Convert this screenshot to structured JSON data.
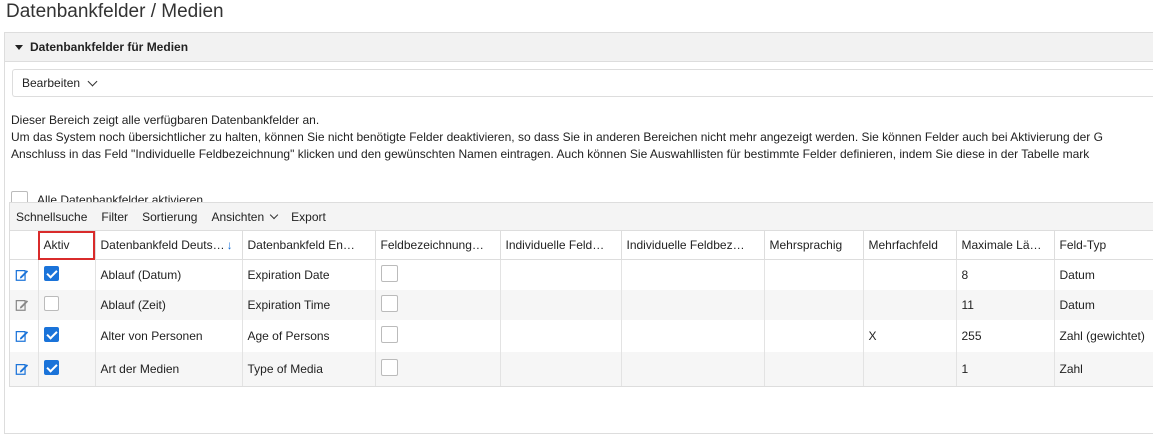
{
  "page": {
    "title": "Datenbankfelder / Medien"
  },
  "panel": {
    "title": "Datenbankfelder für Medien"
  },
  "edit_menu": {
    "label": "Bearbeiten"
  },
  "description": {
    "line1": "Dieser Bereich zeigt alle verfügbaren Datenbankfelder an.",
    "line2": "Um das System noch übersichtlicher zu halten, können Sie nicht benötigte Felder deaktivieren, so dass Sie in anderen Bereichen nicht mehr angezeigt werden. Sie können Felder auch bei Aktivierung der G",
    "line3": "Anschluss in das Feld \"Individuelle Feldbezeichnung\" klicken und den gewünschten Namen eintragen. Auch können Sie Auswahllisten für bestimmte Felder definieren, indem Sie diese in der Tabelle mark"
  },
  "activate_all": {
    "label": "Alle Datenbankfelder aktivieren",
    "checked": false
  },
  "toolbar": {
    "quicksearch": "Schnellsuche",
    "filter": "Filter",
    "sort": "Sortierung",
    "views": "Ansichten",
    "export": "Export"
  },
  "table": {
    "headers": {
      "aktiv": "Aktiv",
      "feld_de": "Datenbankfeld Deuts…",
      "feld_en": "Datenbankfeld En…",
      "feldbez": "Feldbezeichnung…",
      "indiv1": "Individuelle Feld…",
      "indiv2": "Individuelle Feldbez…",
      "mehrsprachig": "Mehrsprachig",
      "mehrfach": "Mehrfachfeld",
      "maxlen": "Maximale Lä…",
      "typ": "Feld-Typ"
    },
    "colors": {
      "accent": "#1a73d9",
      "highlight": "#d92b2b"
    },
    "rows": [
      {
        "aktiv": true,
        "feld_de": "Ablauf (Datum)",
        "feld_en": "Expiration Date",
        "mehrfach": "",
        "maxlen": "8",
        "typ": "Datum"
      },
      {
        "aktiv": false,
        "feld_de": "Ablauf (Zeit)",
        "feld_en": "Expiration Time",
        "mehrfach": "",
        "maxlen": "11",
        "typ": "Datum"
      },
      {
        "aktiv": true,
        "feld_de": "Alter von Personen",
        "feld_en": "Age of Persons",
        "mehrfach": "X",
        "maxlen": "255",
        "typ": "Zahl (gewichtet)"
      },
      {
        "aktiv": true,
        "feld_de": "Art der Medien",
        "feld_en": "Type of Media",
        "mehrfach": "",
        "maxlen": "1",
        "typ": "Zahl"
      }
    ]
  }
}
